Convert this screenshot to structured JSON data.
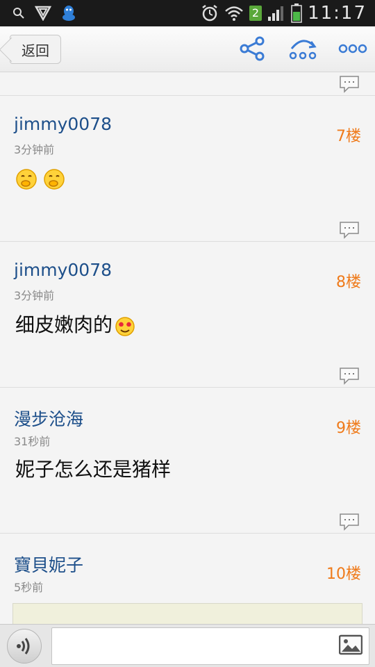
{
  "status_bar": {
    "time": "11:17",
    "notification_count": "2",
    "icons": [
      "search-icon",
      "vpn-shield-icon",
      "qq-icon",
      "alarm-icon",
      "wifi-icon",
      "signal-icon",
      "battery-icon"
    ]
  },
  "topbar": {
    "back_label": "返回",
    "actions": [
      "share-icon",
      "forward-icon",
      "more-icon"
    ]
  },
  "posts": [
    {
      "username": "jimmy0078",
      "time": "3分钟前",
      "floor": "7楼",
      "text": "",
      "emojis": [
        "giggle-emoji-icon",
        "giggle-emoji-icon"
      ]
    },
    {
      "username": "jimmy0078",
      "time": "3分钟前",
      "floor": "8楼",
      "text": "细皮嫩肉的",
      "emojis": [
        "heart-eyes-emoji-icon"
      ]
    },
    {
      "username": "漫步沧海",
      "time": "31秒前",
      "floor": "9楼",
      "text": "妮子怎么还是猪样",
      "emojis": []
    },
    {
      "username": "寶貝妮子",
      "time": "5秒前",
      "floor": "10楼",
      "text": "",
      "emojis": []
    }
  ],
  "bottom_bar": {
    "input_value": "",
    "input_placeholder": ""
  },
  "colors": {
    "username": "#1d4f8a",
    "floor": "#ef7a1a",
    "icon_blue": "#3a7bd5"
  }
}
